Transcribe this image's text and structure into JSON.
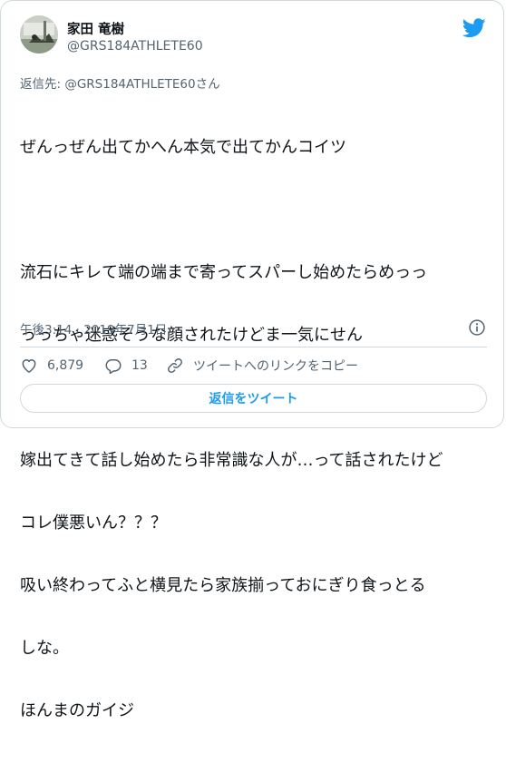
{
  "tweet": {
    "display_name": "家田 竜樹",
    "handle": "@GRS184ATHLETE60",
    "replying_to": "返信先: @GRS184ATHLETE60さん",
    "body_lines": [
      "ぜんっぜん出てかへん本気で出てかんコイツ",
      "",
      "流石にキレて端の端まで寄ってスパーし始めたらめっっ",
      "っっちゃ迷惑そうな顔されたけどま一気にせん",
      "",
      "嫁出てきて話し始めたら非常識な人が…って話されたけど",
      "コレ僕悪いん？？？",
      "吸い終わってふと横見たら家族揃っておにぎり食っとる",
      "しな。",
      "ほんまのガイジ"
    ],
    "timestamp": "午後3:14 · 2019年7月1日"
  },
  "actions": {
    "likes": "6,879",
    "replies": "13",
    "copy_link": "ツイートへのリンクをコピー"
  },
  "reply_button_label": "返信をツイート",
  "colors": {
    "accent": "#1d9bf0",
    "muted_text": "#536471",
    "border": "#cfd9de"
  },
  "icons": [
    "twitter-bird-icon",
    "info-icon",
    "heart-icon",
    "reply-bubble-icon",
    "link-icon"
  ]
}
